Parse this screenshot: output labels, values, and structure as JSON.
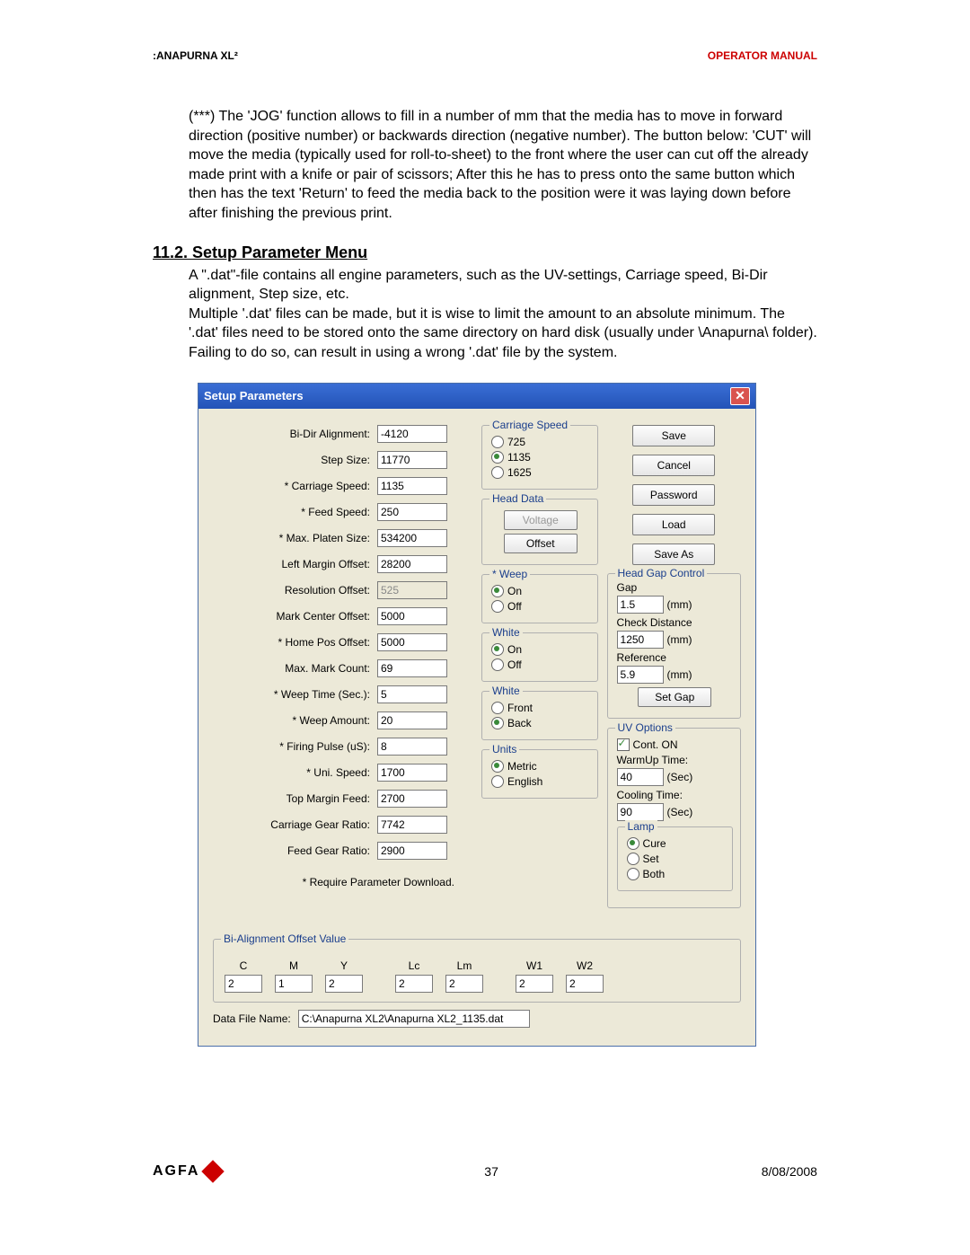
{
  "header": {
    "left": ":ANAPURNA XL²",
    "right": "OPERATOR MANUAL"
  },
  "para1": "(***) The 'JOG' function allows to fill in a number of mm that the media has to move in forward direction (positive number) or backwards direction (negative number). The button below: 'CUT' will move the media (typically used for roll-to-sheet) to the front where the user can cut off the already made print with a knife or pair of scissors; After this he has to press onto the same button which then has the text 'Return' to feed the media back to the position were it was laying down before after finishing the previous print.",
  "section_heading": "11.2. Setup Parameter Menu",
  "para2a": "A  \".dat\"-file contains all engine parameters, such as the UV-settings, Carriage speed, Bi-Dir alignment, Step size, etc.",
  "para2b": "Multiple '.dat' files can be made, but it is wise to limit the amount to an absolute minimum.  The '.dat' files need to be stored onto the same directory on hard disk (usually under \\Anapurna\\ folder).  Failing to do so, can result in using a wrong '.dat' file by the system.",
  "dialog": {
    "title": "Setup Parameters",
    "params": [
      {
        "label": "Bi-Dir Alignment:",
        "value": "-4120"
      },
      {
        "label": "Step Size:",
        "value": "11770"
      },
      {
        "label": "* Carriage Speed:",
        "value": "1135"
      },
      {
        "label": "* Feed Speed:",
        "value": "250"
      },
      {
        "label": "* Max. Platen Size:",
        "value": "534200"
      },
      {
        "label": "Left Margin Offset:",
        "value": "28200"
      },
      {
        "label": "Resolution Offset:",
        "value": "525",
        "disabled": true
      },
      {
        "label": "Mark Center Offset:",
        "value": "5000"
      },
      {
        "label": "* Home Pos Offset:",
        "value": "5000"
      },
      {
        "label": "Max. Mark Count:",
        "value": "69"
      },
      {
        "label": "* Weep  Time (Sec.):",
        "value": "5"
      },
      {
        "label": "* Weep Amount:",
        "value": "20"
      },
      {
        "label": "* Firing Pulse (uS):",
        "value": "8"
      },
      {
        "label": "* Uni. Speed:",
        "value": "1700"
      },
      {
        "label": "Top Margin Feed:",
        "value": "2700"
      },
      {
        "label": "Carriage Gear Ratio:",
        "value": "7742"
      },
      {
        "label": "Feed Gear Ratio:",
        "value": "2900"
      }
    ],
    "require_note": "* Require Parameter Download.",
    "carriage_speed": {
      "title": "Carriage Speed",
      "options": [
        "725",
        "1135",
        "1625"
      ],
      "selected": 1
    },
    "head_data": {
      "title": "Head Data",
      "voltage_btn": "Voltage",
      "offset_btn": "Offset"
    },
    "weep": {
      "title": "* Weep",
      "on": "On",
      "off": "Off",
      "selected": "on"
    },
    "white": {
      "title": "White",
      "on": "On",
      "off": "Off",
      "selected": "on"
    },
    "white_pos": {
      "title": "White",
      "front": "Front",
      "back": "Back",
      "selected": "back"
    },
    "units": {
      "title": "Units",
      "metric": "Metric",
      "english": "English",
      "selected": "metric"
    },
    "buttons": {
      "save": "Save",
      "cancel": "Cancel",
      "password": "Password",
      "load": "Load",
      "saveas": "Save As",
      "setgap": "Set Gap"
    },
    "head_gap": {
      "title": "Head Gap Control",
      "gap_label": "Gap",
      "gap_value": "1.5",
      "gap_unit": "(mm)",
      "check_label": "Check Distance",
      "check_value": "1250",
      "check_unit": "(mm)",
      "ref_label": "Reference",
      "ref_value": "5.9",
      "ref_unit": "(mm)"
    },
    "uv": {
      "title": "UV Options",
      "cont_on": "Cont. ON",
      "warmup_label": "WarmUp Time:",
      "warmup_value": "40",
      "warmup_unit": "(Sec)",
      "cooling_label": "Cooling Time:",
      "cooling_value": "90",
      "cooling_unit": "(Sec)",
      "lamp_title": "Lamp",
      "lamp_opts": [
        "Cure",
        "Set",
        "Both"
      ],
      "lamp_selected": 0
    },
    "bi_align": {
      "title": "Bi-Alignment Offset Value",
      "headers": [
        "C",
        "M",
        "Y",
        "Lc",
        "Lm",
        "W1",
        "W2"
      ],
      "values": [
        "2",
        "1",
        "2",
        "2",
        "2",
        "2",
        "2"
      ]
    },
    "file": {
      "label": "Data File Name:",
      "value": "C:\\Anapurna XL2\\Anapurna XL2_1135.dat"
    }
  },
  "footer": {
    "brand": "AGFA",
    "page": "37",
    "date": "8/08/2008"
  }
}
